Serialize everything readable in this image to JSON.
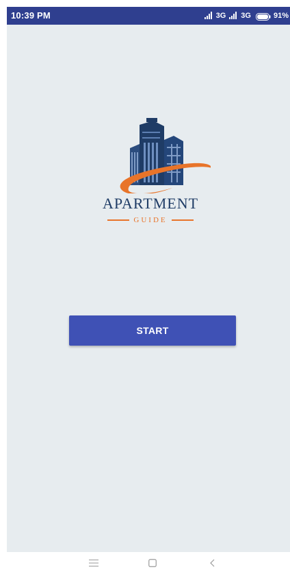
{
  "status_bar": {
    "time": "10:39 PM",
    "network_1": "3G",
    "network_2": "3G",
    "battery": "91%",
    "background": "#2f3f8f"
  },
  "logo": {
    "word": "APARTMENT",
    "sub": "GUIDE",
    "brand_color": "#1f3c66",
    "accent_color": "#e8742a"
  },
  "start_button": {
    "label": "START",
    "color": "#3f51b5"
  },
  "nav_bar": {
    "icons": [
      "menu-icon",
      "home-square-icon",
      "back-chevron-icon"
    ]
  }
}
